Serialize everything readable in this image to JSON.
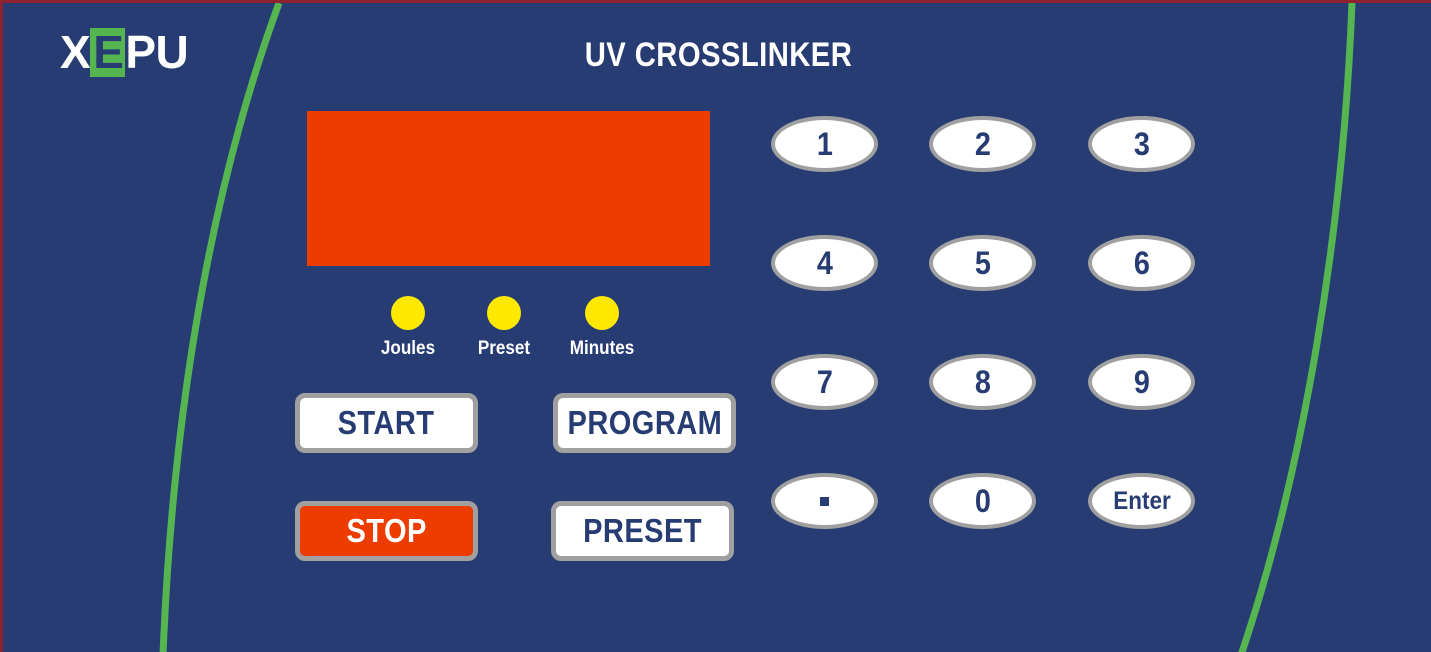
{
  "device": {
    "brand_prefix": "X",
    "brand_highlight": "E",
    "brand_suffix": "PU",
    "title": "UV CROSSLINKER"
  },
  "colors": {
    "panel_blue": "#273c72",
    "accent_green": "#55b651",
    "display_orange": "#ec3c00",
    "led_yellow": "#ffe800",
    "button_border_gray": "#a0a0a0",
    "button_white": "#ffffff",
    "border_maroon": "#8f2230"
  },
  "display": {
    "value": "",
    "placeholder": ""
  },
  "indicators": [
    {
      "label": "Joules",
      "state": "on",
      "color": "#ffe800"
    },
    {
      "label": "Preset",
      "state": "on",
      "color": "#ffe800"
    },
    {
      "label": "Minutes",
      "state": "on",
      "color": "#ffe800"
    }
  ],
  "controls": [
    {
      "label": "START",
      "style": "light"
    },
    {
      "label": "PROGRAM",
      "style": "light"
    },
    {
      "label": "STOP",
      "style": "danger"
    },
    {
      "label": "PRESET",
      "style": "light"
    }
  ],
  "keypad": {
    "keys": [
      {
        "label": "1"
      },
      {
        "label": "2"
      },
      {
        "label": "3"
      },
      {
        "label": "4"
      },
      {
        "label": "5"
      },
      {
        "label": "6"
      },
      {
        "label": "7"
      },
      {
        "label": "8"
      },
      {
        "label": "9"
      },
      {
        "label": "."
      },
      {
        "label": "0"
      },
      {
        "label": "Enter"
      }
    ]
  }
}
